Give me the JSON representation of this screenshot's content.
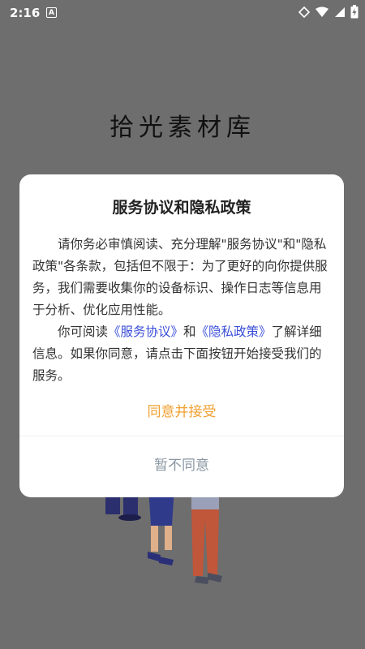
{
  "status_bar": {
    "time": "2:16",
    "notification_icon_letter": "A"
  },
  "app": {
    "title": "拾光素材库"
  },
  "dialog": {
    "title": "服务协议和隐私政策",
    "paragraph1": "请你务必审慎阅读、充分理解\"服务协议\"和\"隐私政策\"各条款，包括但不限于：为了更好的向你提供服务，我们需要收集你的设备标识、操作日志等信息用于分析、优化应用性能。",
    "paragraph2": {
      "prefix": "你可阅读",
      "service_link": "《服务协议》",
      "middle": "和",
      "privacy_link": "《隐私政策》",
      "suffix": "了解详细信息。如果你同意，请点击下面按钮开始接受我们的服务。"
    },
    "accept_label": "同意并接受",
    "decline_label": "暂不同意"
  },
  "colors": {
    "overlay": "#6e6e6e",
    "accept": "#f0a030",
    "decline": "#8a96a3",
    "link": "#3b4fd8"
  }
}
